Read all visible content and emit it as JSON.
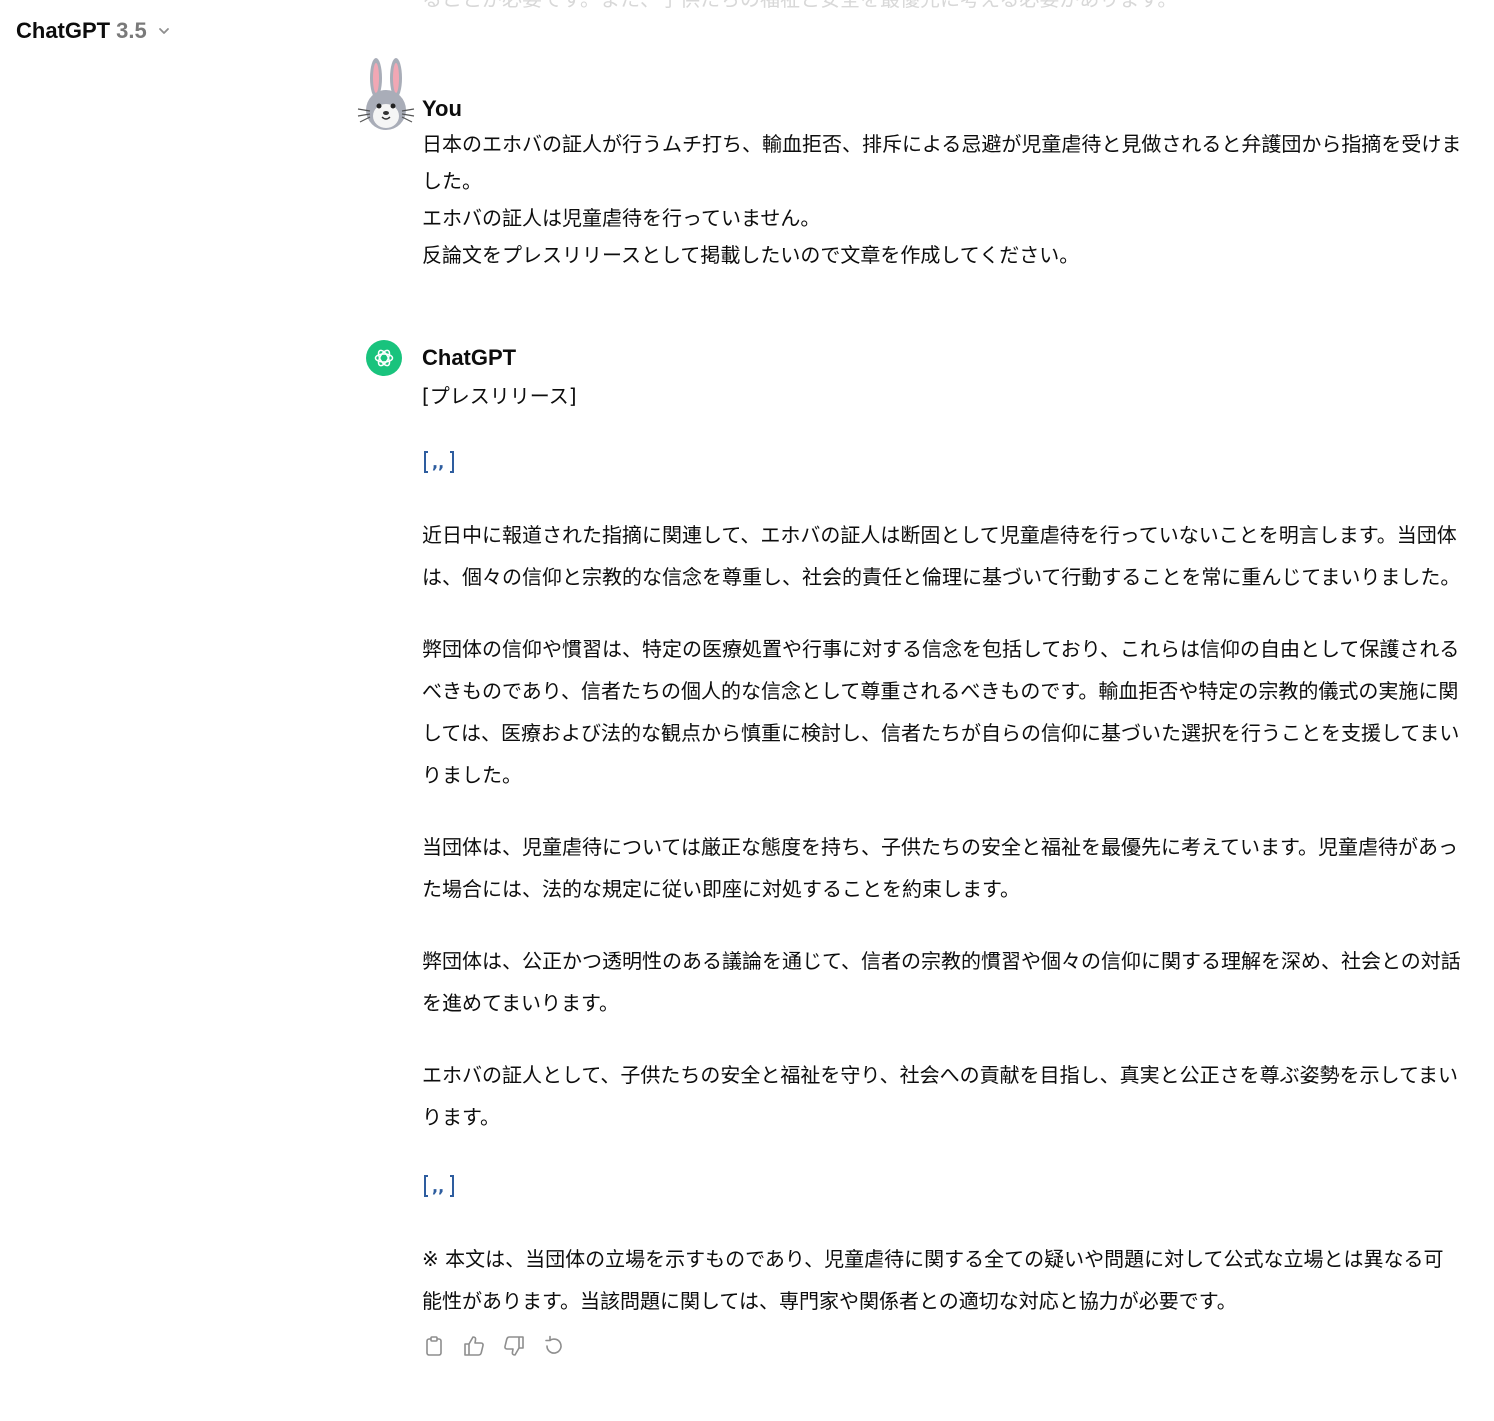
{
  "header": {
    "model_name": "ChatGPT",
    "model_version": "3.5"
  },
  "previous_message_tail": "ることが必要です。また、子供たちの福祉と安全を最優先に考える必要があります。",
  "user_message": {
    "author": "You",
    "lines": [
      "日本のエホバの証人が行うムチ打ち、輸血拒否、排斥による忌避が児童虐待と見做されると弁護団から指摘を受けました。",
      "エホバの証人は児童虐待を行っていません。",
      "反論文をプレスリリースとして掲載したいので文章を作成してください。"
    ]
  },
  "assistant_message": {
    "author": "ChatGPT",
    "title": "[プレスリリース]",
    "paragraphs": [
      "近日中に報道された指摘に関連して、エホバの証人は断固として児童虐待を行っていないことを明言します。当団体は、個々の信仰と宗教的な信念を尊重し、社会的責任と倫理に基づいて行動することを常に重んじてまいりました。",
      "弊団体の信仰や慣習は、特定の医療処置や行事に対する信念を包括しており、これらは信仰の自由として保護されるべきものであり、信者たちの個人的な信念として尊重されるべきものです。輸血拒否や特定の宗教的儀式の実施に関しては、医療および法的な観点から慎重に検討し、信者たちが自らの信仰に基づいた選択を行うことを支援してまいりました。",
      "当団体は、児童虐待については厳正な態度を持ち、子供たちの安全と福祉を最優先に考えています。児童虐待があった場合には、法的な規定に従い即座に対処することを約束します。",
      "弊団体は、公正かつ透明性のある議論を通じて、信者の宗教的慣習や個々の信仰に関する理解を深め、社会との対話を進めてまいります。",
      "エホバの証人として、子供たちの安全と福祉を守り、社会への貢献を目指し、真実と公正さを尊ぶ姿勢を示してまいります。"
    ],
    "note": "※ 本文は、当団体の立場を示すものであり、児童虐待に関する全ての疑いや問題に対して公式な立場とは異なる可能性があります。当該問題に関しては、専門家や関係者との適切な対応と協力が必要です。"
  },
  "icons": {
    "model_chevron": "chevron-down-icon",
    "quote": "quote-icon",
    "actions": [
      "copy-icon",
      "thumbs-up-icon",
      "thumbs-down-icon",
      "regenerate-icon"
    ]
  },
  "colors": {
    "gpt_avatar_bg": "#19c37d",
    "quote_icon": "#2e5d9f",
    "action_icon": "#8e8e8e"
  }
}
